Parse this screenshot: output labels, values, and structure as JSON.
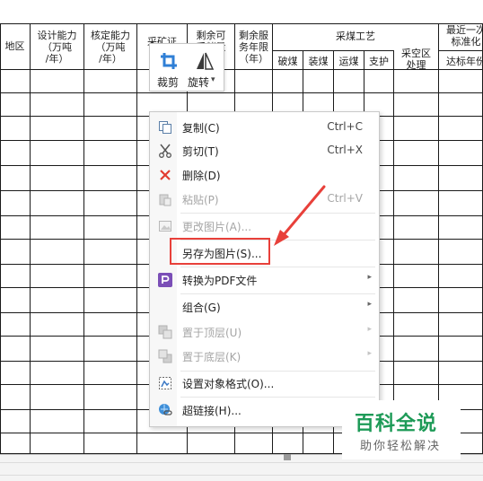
{
  "table_header": {
    "region": "地区",
    "design_capacity": "设计能力\n（万吨\n/年）",
    "approved_capacity": "核定能力\n（万吨\n/年）",
    "mining_cert_partial": "采矿证\n有",
    "remaining_partial": "剩余可\n采储量",
    "remaining_years": "剩余服\n务年限\n（年）",
    "mining_process": "采煤工艺",
    "sub_breaking": "破煤",
    "sub_loading": "装煤",
    "sub_transport": "运煤",
    "sub_support": "支护",
    "goaf": "采空区\n处理",
    "recent_partial": "最近一次\n标准化",
    "standard_year": "达标年份"
  },
  "mini_toolbar": {
    "crop_label": "裁剪",
    "rotate_label": "旋转",
    "rotate_arrow": "▾"
  },
  "context_menu": {
    "items": [
      {
        "label": "复制(C)",
        "shortcut": "Ctrl+C",
        "icon": "copy-icon"
      },
      {
        "label": "剪切(T)",
        "shortcut": "Ctrl+X",
        "icon": "scissors-icon"
      },
      {
        "label": "删除(D)",
        "shortcut": "",
        "icon": "delete-icon"
      },
      {
        "label": "粘贴(P)",
        "shortcut": "Ctrl+V",
        "icon": "paste-icon"
      },
      {
        "label": "更改图片(A)...",
        "shortcut": "",
        "icon": "change-picture-icon"
      },
      {
        "label": "另存为图片(S)...",
        "shortcut": "",
        "icon": ""
      },
      {
        "label": "转换为PDF文件",
        "shortcut": "",
        "icon": "pdf-icon"
      },
      {
        "label": "组合(G)",
        "shortcut": "",
        "icon": ""
      },
      {
        "label": "置于顶层(U)",
        "shortcut": "",
        "icon": "bring-to-front-icon"
      },
      {
        "label": "置于底层(K)",
        "shortcut": "",
        "icon": "send-to-back-icon"
      },
      {
        "label": "设置对象格式(O)...",
        "shortcut": "",
        "icon": "format-object-icon"
      },
      {
        "label": "超链接(H)...",
        "shortcut": "Ct",
        "icon": "hyperlink-icon"
      }
    ],
    "submenu_arrow": "▸"
  },
  "colors": {
    "annotation_red": "#e8403a",
    "watermark_green": "#1d9a57"
  },
  "watermark": {
    "title": "百科全说",
    "subtitle": "助你轻松解决"
  }
}
